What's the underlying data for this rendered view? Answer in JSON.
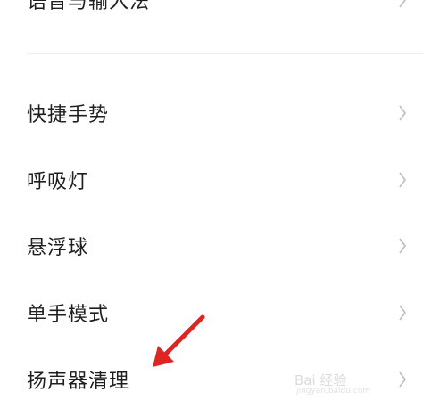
{
  "settings": {
    "items": [
      {
        "label": "语音与输入法"
      },
      {
        "label": "快捷手势"
      },
      {
        "label": "呼吸灯"
      },
      {
        "label": "悬浮球"
      },
      {
        "label": "单手模式"
      },
      {
        "label": "扬声器清理"
      }
    ]
  },
  "annotation": {
    "arrow_color": "#e02424"
  },
  "watermark": {
    "text": "Bai 经验",
    "sub": "jingyan.baidu.com"
  },
  "icons": {
    "chevron": "chevron-right-icon"
  }
}
